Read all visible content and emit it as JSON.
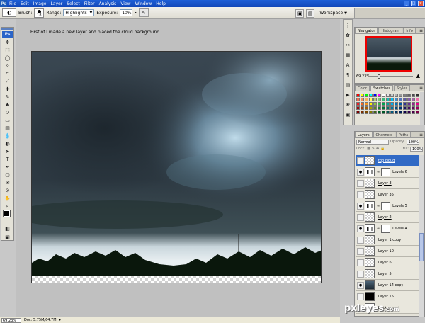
{
  "menubar": {
    "logo": "Ps",
    "items": [
      "File",
      "Edit",
      "Image",
      "Layer",
      "Select",
      "Filter",
      "Analysis",
      "View",
      "Window",
      "Help"
    ],
    "window_buttons": [
      "_",
      "□",
      "×"
    ]
  },
  "options": {
    "brush_label": "Brush:",
    "brush_size": "18",
    "range_label": "Range:",
    "range_value": "Highlights",
    "exposure_label": "Exposure:",
    "exposure_value": "10%",
    "workspace_label": "Workspace"
  },
  "document": {
    "caption": "First of I made a new layer and placed the cloud background"
  },
  "statusbar": {
    "zoom": "69.23%",
    "doc_info": "Doc: 5.75M/64.7M"
  },
  "navigator": {
    "tabs": [
      "Navigator",
      "Histogram",
      "Info"
    ],
    "zoom": "69.23%"
  },
  "swatches_panel": {
    "tabs": [
      "Color",
      "Swatches",
      "Styles"
    ],
    "colors": [
      "#ff0000",
      "#ffff00",
      "#00ff00",
      "#00ffff",
      "#0000ff",
      "#ff00ff",
      "#ffffff",
      "#e6e6e6",
      "#cccccc",
      "#b3b3b3",
      "#999999",
      "#808080",
      "#666666",
      "#4d4d4d",
      "#333333",
      "#000000",
      "#f26c4f",
      "#f68e55",
      "#fbaf5c",
      "#fff467",
      "#acd372",
      "#7cc576",
      "#3bb878",
      "#1abbb4",
      "#00bff3",
      "#438ccb",
      "#5574b9",
      "#605ca8",
      "#855fa8",
      "#a763a8",
      "#f06ea9",
      "#f26d7d",
      "#ed1c24",
      "#f26522",
      "#f7941d",
      "#fff200",
      "#8dc63f",
      "#39b54a",
      "#00a651",
      "#00a99d",
      "#00aeef",
      "#0072bc",
      "#0054a6",
      "#2e3192",
      "#662d91",
      "#92278f",
      "#ec008c",
      "#ed145b",
      "#9e0b0f",
      "#a0410d",
      "#a36209",
      "#aba000",
      "#598527",
      "#197b30",
      "#007236",
      "#00746b",
      "#0076a3",
      "#004b80",
      "#003471",
      "#1b1464",
      "#440e62",
      "#630460",
      "#9e005d",
      "#9e0039",
      "#790000",
      "#7b2e00",
      "#7d4900",
      "#827b00",
      "#406618",
      "#005e20",
      "#005826",
      "#005952",
      "#005b7f",
      "#003663",
      "#002157",
      "#0d004c",
      "#32004b",
      "#4b0049",
      "#7b0046",
      "#7a0026"
    ]
  },
  "layers_panel": {
    "tabs": [
      "Layers",
      "Channels",
      "Paths"
    ],
    "blend_mode": "Normal",
    "opacity_label": "Opacity:",
    "opacity_value": "100%",
    "lock_label": "Lock:",
    "fill_label": "Fill:",
    "fill_value": "100%",
    "items": [
      {
        "name": "top cloud",
        "thumb": "checker",
        "selected": true,
        "visible": false,
        "mask": false,
        "underlined": true
      },
      {
        "name": "Levels 6",
        "thumb": "levels",
        "selected": false,
        "visible": true,
        "mask": true,
        "underlined": false
      },
      {
        "name": "Layer 3",
        "thumb": "checker",
        "selected": false,
        "visible": false,
        "mask": false,
        "underlined": true
      },
      {
        "name": "Layer 35",
        "thumb": "checker",
        "selected": false,
        "visible": false,
        "mask": false,
        "underlined": false
      },
      {
        "name": "Levels 5",
        "thumb": "levels",
        "selected": false,
        "visible": true,
        "mask": true,
        "underlined": false
      },
      {
        "name": "Layer 2",
        "thumb": "checker",
        "selected": false,
        "visible": false,
        "mask": false,
        "underlined": true
      },
      {
        "name": "Levels 4",
        "thumb": "levels",
        "selected": false,
        "visible": true,
        "mask": true,
        "underlined": false
      },
      {
        "name": "Layer 1 copy",
        "thumb": "checker",
        "selected": false,
        "visible": false,
        "mask": false,
        "underlined": true
      },
      {
        "name": "Layer 10",
        "thumb": "checker",
        "selected": false,
        "visible": false,
        "mask": false,
        "underlined": false
      },
      {
        "name": "Layer 6",
        "thumb": "checker",
        "selected": false,
        "visible": false,
        "mask": false,
        "underlined": false
      },
      {
        "name": "Layer 5",
        "thumb": "checker",
        "selected": false,
        "visible": false,
        "mask": false,
        "underlined": false
      },
      {
        "name": "Layer 14 copy",
        "thumb": "cloud",
        "selected": false,
        "visible": true,
        "mask": false,
        "underlined": false
      },
      {
        "name": "Layer 15",
        "thumb": "dark",
        "selected": false,
        "visible": false,
        "mask": false,
        "underlined": false
      },
      {
        "name": "Background",
        "thumb": "white",
        "selected": false,
        "visible": false,
        "mask": false,
        "underlined": false
      }
    ]
  },
  "watermark": {
    "brand": "pxleyes",
    "suffix": ".com"
  }
}
